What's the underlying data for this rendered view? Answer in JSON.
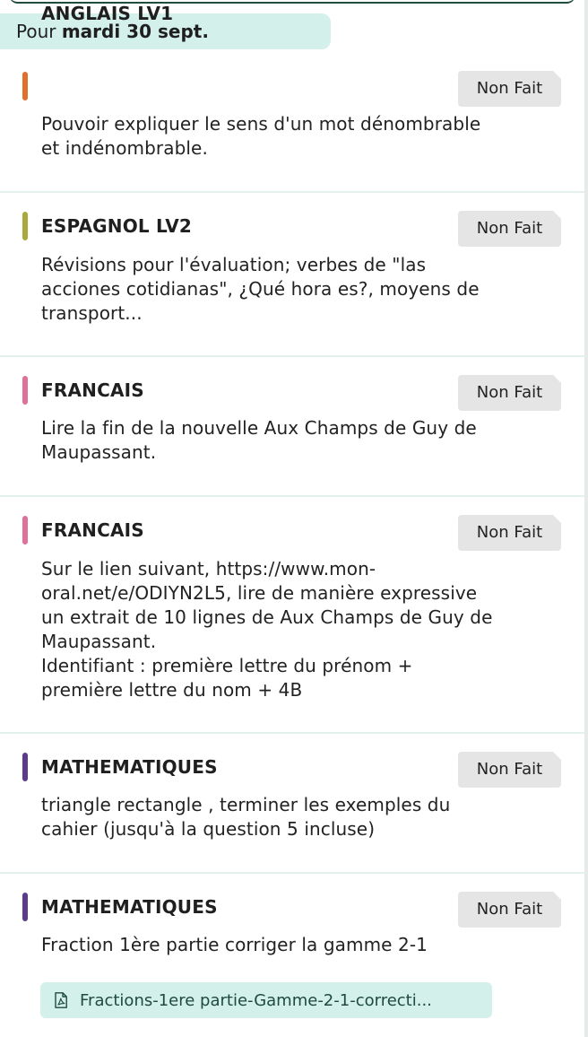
{
  "header": {
    "date_prefix": "Pour",
    "date_value": "mardi 30 sept."
  },
  "colors": {
    "accent": "#1f4d40",
    "chip_background": "#d3f0eb",
    "status_background": "#e5e5e5"
  },
  "homework": [
    {
      "subject": "ANGLAIS LV1",
      "subject_color": "#e06f2c",
      "status": "Non Fait",
      "description": [
        "Pouvoir expliquer le sens d'un mot dénombrable",
        "et indénombrable."
      ]
    },
    {
      "subject": "ESPAGNOL LV2",
      "subject_color": "#a9aa3a",
      "status": "Non Fait",
      "description": [
        "Révisions pour l'évaluation; verbes de \"las",
        "acciones cotidianas\", ¿Qué hora es?, moyens de",
        "transport..."
      ]
    },
    {
      "subject": "FRANCAIS",
      "subject_color": "#e0709a",
      "status": "Non Fait",
      "description": [
        "Lire la fin de la nouvelle Aux Champs de Guy de",
        "Maupassant."
      ]
    },
    {
      "subject": "FRANCAIS",
      "subject_color": "#e0709a",
      "status": "Non Fait",
      "description": [
        "Sur le lien suivant, https://www.mon-",
        "oral.net/e/ODIYN2L5, lire de manière expressive",
        "un extrait de 10 lignes de Aux Champs de Guy de",
        "Maupassant.",
        "Identifiant : première lettre du prénom +",
        "première lettre du nom + 4B"
      ]
    },
    {
      "subject": "MATHEMATIQUES",
      "subject_color": "#5b3b8c",
      "status": "Non Fait",
      "description": [
        "triangle rectangle , terminer les exemples du",
        "cahier (jusqu'à la question 5 incluse)"
      ]
    },
    {
      "subject": "MATHEMATIQUES",
      "subject_color": "#5b3b8c",
      "status": "Non Fait",
      "description": [
        "Fraction 1ère partie corriger la gamme 2-1"
      ],
      "attachment": {
        "icon": "pdf-file-icon",
        "label": "Fractions-1ere partie-Gamme-2-1-correcti..."
      }
    }
  ]
}
